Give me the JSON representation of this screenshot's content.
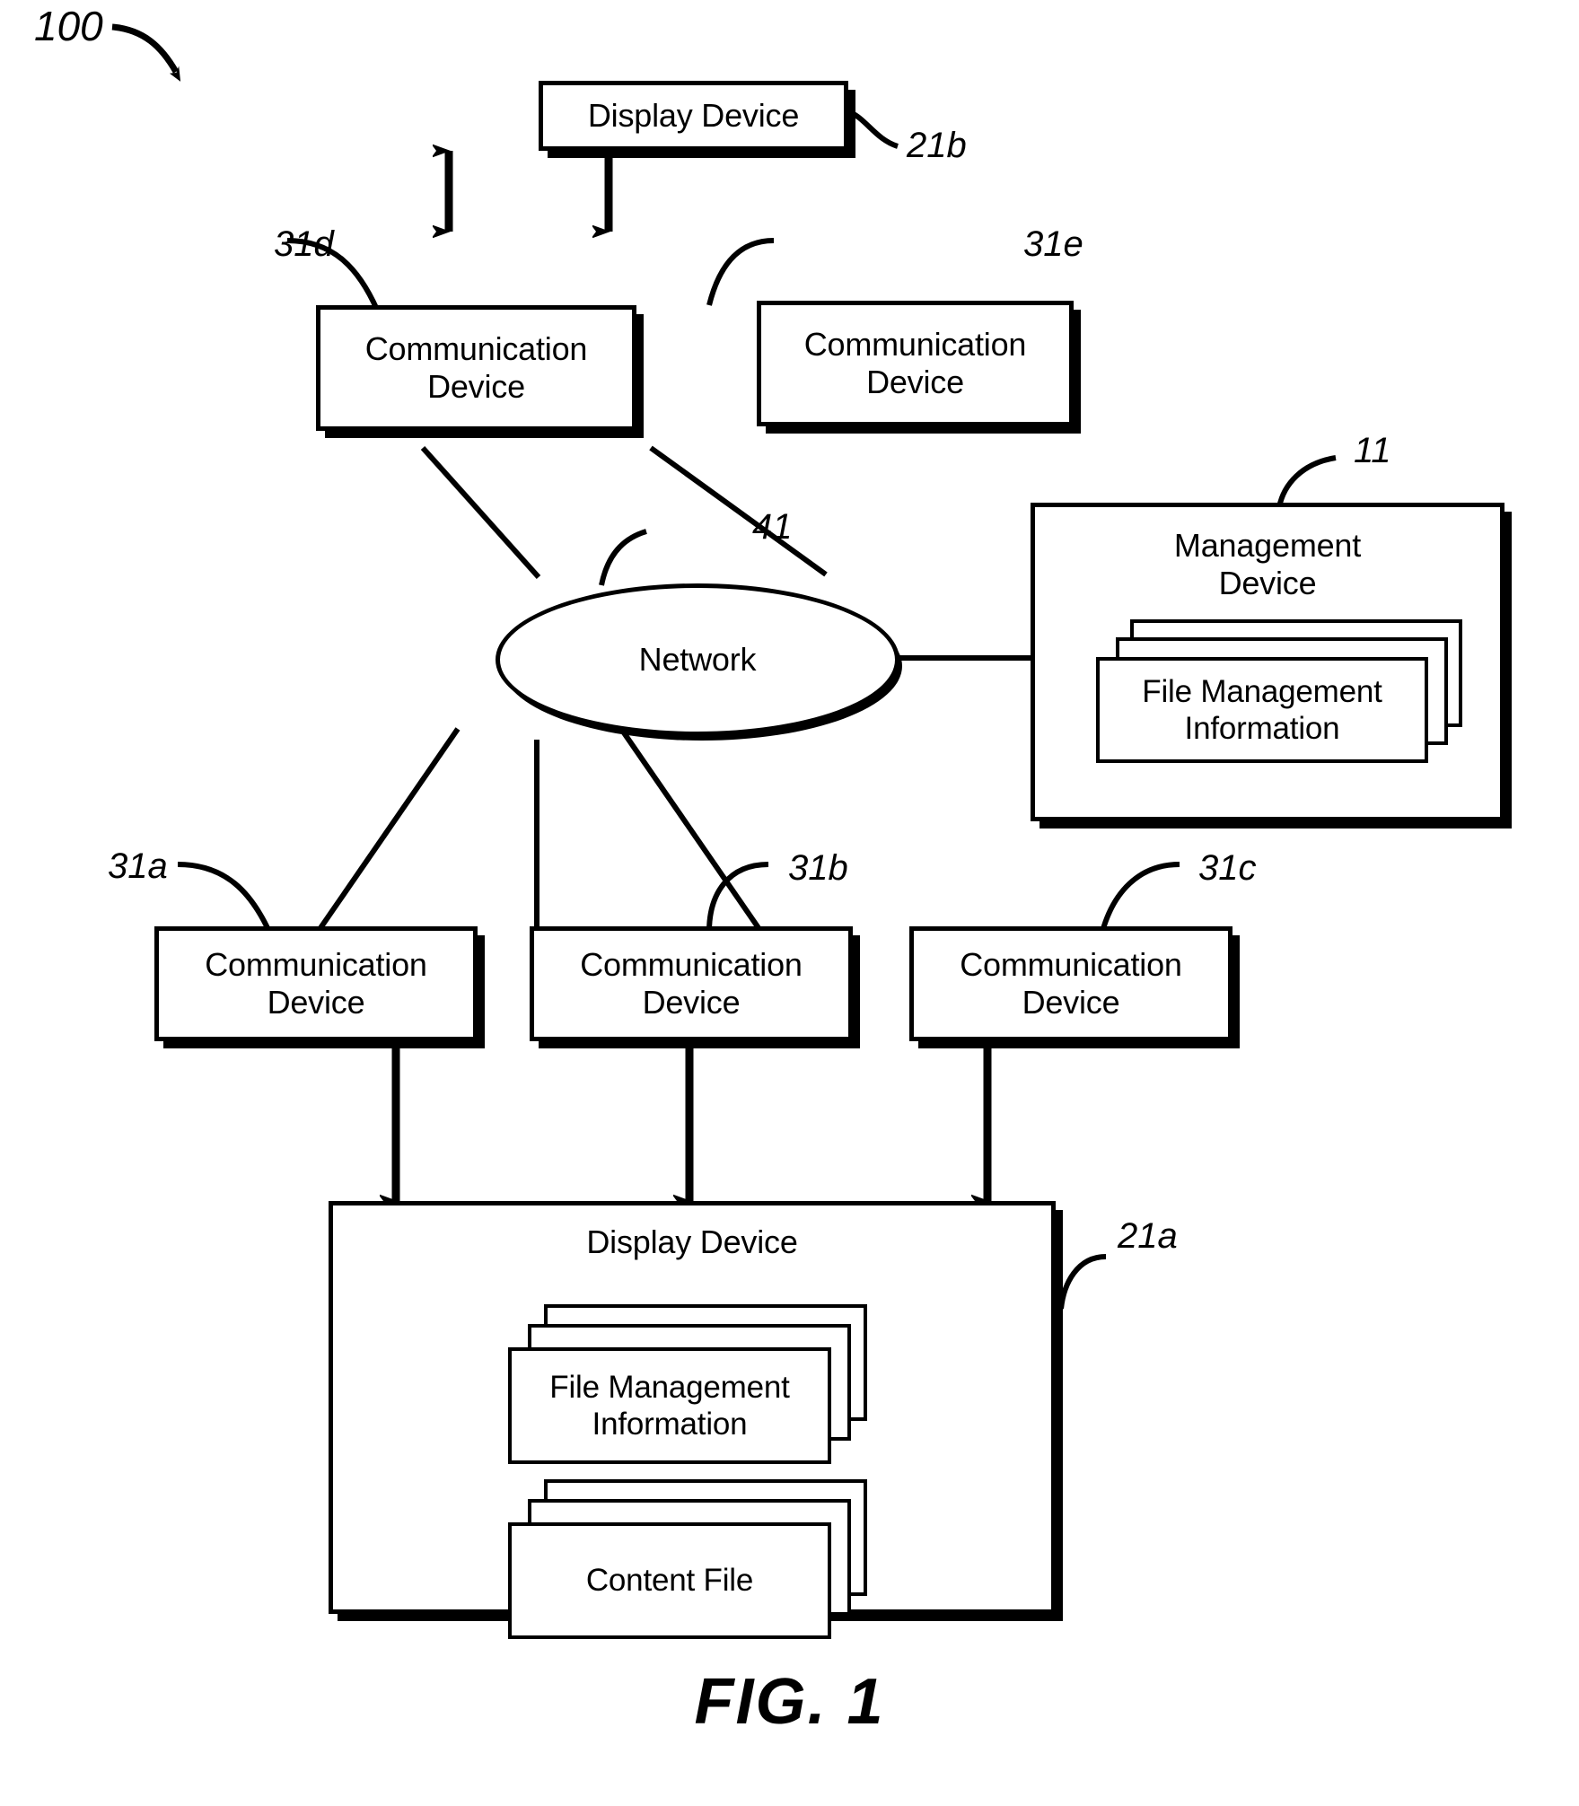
{
  "figure": {
    "caption": "FIG. 1",
    "system_numeral": "100"
  },
  "nodes": {
    "display_device_top": {
      "label": "Display Device",
      "numeral": "21b"
    },
    "comm_device_d": {
      "label": "Communication\nDevice",
      "numeral": "31d"
    },
    "comm_device_e": {
      "label": "Communication\nDevice",
      "numeral": "31e"
    },
    "network": {
      "label": "Network",
      "numeral": "41"
    },
    "management_device": {
      "label": "Management\nDevice",
      "numeral": "11",
      "stack": {
        "label": "File Management\nInformation"
      }
    },
    "comm_device_a": {
      "label": "Communication\nDevice",
      "numeral": "31a"
    },
    "comm_device_b": {
      "label": "Communication\nDevice",
      "numeral": "31b"
    },
    "comm_device_c": {
      "label": "Communication\nDevice",
      "numeral": "31c"
    },
    "display_device_bottom": {
      "label": "Display Device",
      "numeral": "21a",
      "stack_file_management": {
        "label": "File Management\nInformation"
      },
      "stack_content_file": {
        "label": "Content File"
      }
    }
  }
}
